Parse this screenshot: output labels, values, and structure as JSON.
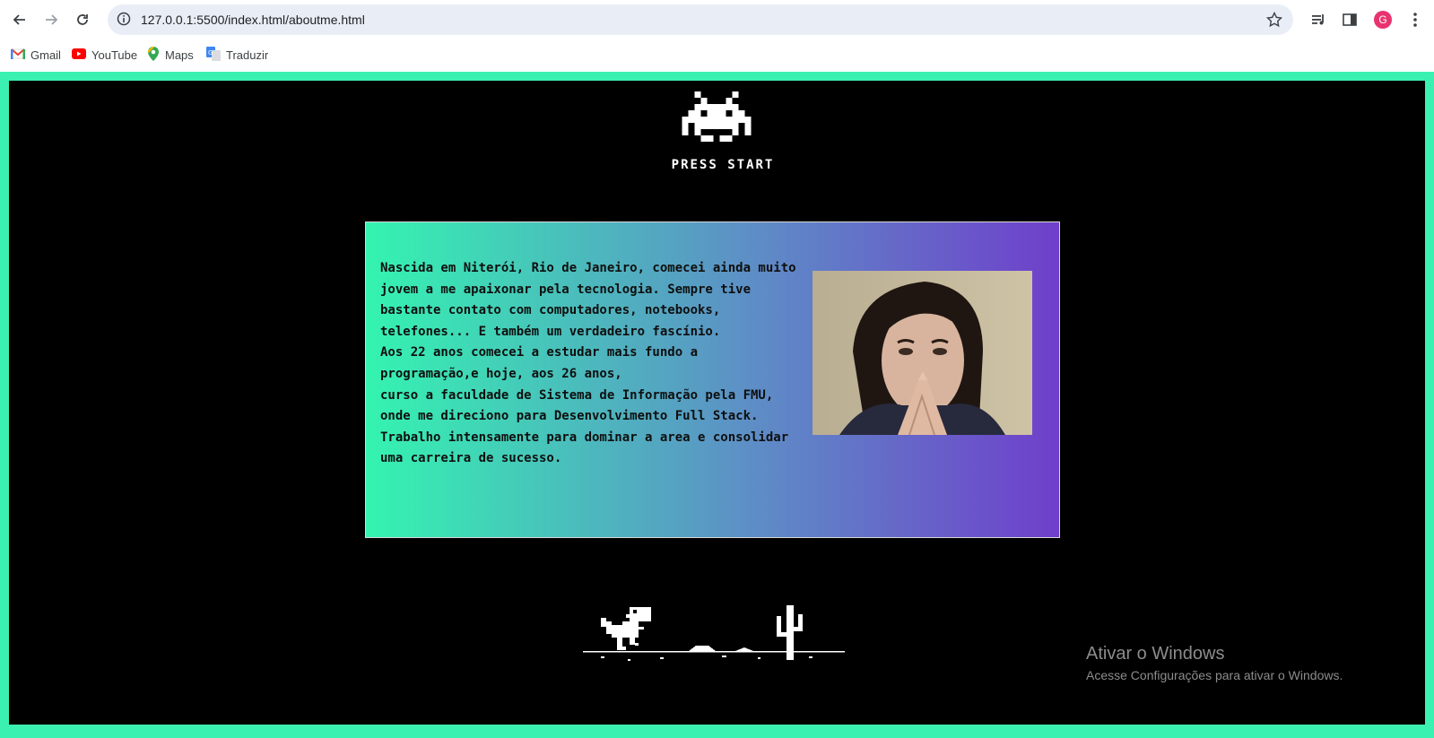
{
  "browser": {
    "url": "127.0.0.1:5500/index.html/aboutme.html",
    "profile_initial": "G",
    "bookmarks": [
      {
        "label": "Gmail",
        "icon": "gmail-icon"
      },
      {
        "label": "YouTube",
        "icon": "youtube-icon"
      },
      {
        "label": "Maps",
        "icon": "maps-icon"
      },
      {
        "label": "Traduzir",
        "icon": "translate-icon"
      }
    ]
  },
  "hero": {
    "icon": "space-invader-icon",
    "press_start": "PRESS START"
  },
  "about": {
    "lines": [
      "Nascida em Niterói, Rio de Janeiro, comecei ainda muito jovem a me apaixonar pela tecnologia. Sempre tive bastante contato com computadores, notebooks, telefones... E também um verdadeiro fascínio.",
      "Aos 22 anos comecei a estudar mais fundo a programação,e hoje, aos 26 anos,",
      "curso a faculdade de Sistema de Informação pela FMU, onde me direciono para Desenvolvimento Full Stack.",
      "Trabalho intensamente para dominar a area e consolidar uma carreira de sucesso."
    ],
    "photo": "profile-photo"
  },
  "footer_art": "dino-cactus-icon",
  "windows_watermark": {
    "title": "Ativar o Windows",
    "subtitle": "Acesse Configurações para ativar o Windows."
  },
  "colors": {
    "page_border": "#3bf1b1",
    "stage_bg": "#000000",
    "card_gradient_start": "#34f4b0",
    "card_gradient_end": "#6f3fcb"
  }
}
